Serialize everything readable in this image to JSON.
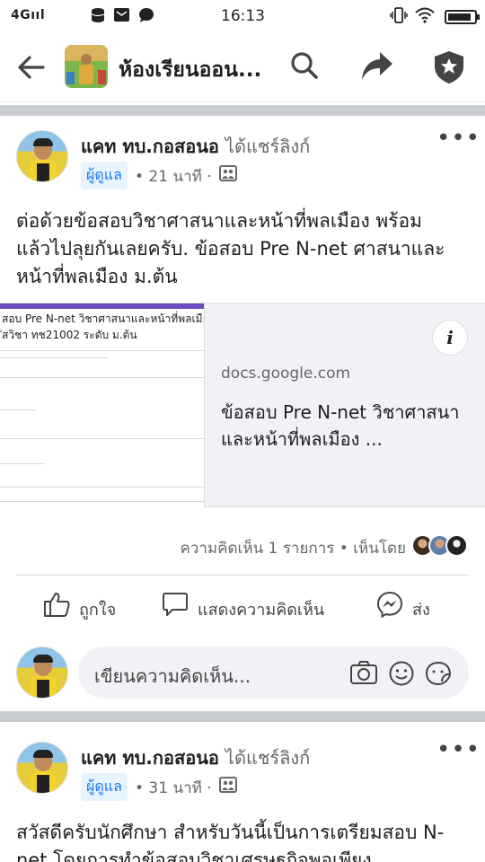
{
  "status_bar": {
    "signal": "4Gııl",
    "time": "16:13",
    "battery_level": 0.9
  },
  "header": {
    "title": "ห้องเรียนออน..."
  },
  "posts": [
    {
      "author": "แคท ทบ.กอสอนอ",
      "shared_text": "ได้แชร์ลิงก์",
      "role_badge": "ผู้ดูแล",
      "time": "• 21 นาที ·",
      "text": "ต่อด้วยข้อสอบวิชาศาสนาและหน้าที่พลเมือง  พร้อมแล้วไปลุยกันเลยครับ. ข้อสอบ Pre N-net ศาสนาและหน้าที่พลเมือง ม.ต้น",
      "link": {
        "thumb_title_line1": "สอบ Pre N-net วิชาศาสนาและหน้าที่พลเมือง",
        "thumb_title_line2": "ัสวิชา ทช21002 ระดับ ม.ต้น",
        "domain": "docs.google.com",
        "title": "ข้อสอบ Pre N-net วิชาศาสนาและหน้าที่พลเมือง ..."
      },
      "comments_summary": "ความคิดเห็น 1 รายการ • เห็นโดย",
      "actions": {
        "like": "ถูกใจ",
        "comment": "แสดงความคิดเห็น",
        "share": "ส่ง"
      },
      "comment_placeholder": "เขียนความคิดเห็น..."
    },
    {
      "author": "แคท ทบ.กอสอนอ",
      "shared_text": "ได้แชร์ลิงก์",
      "role_badge": "ผู้ดูแล",
      "time": "• 31 นาที ·",
      "text": "สวัสดีครับนักศึกษา สำหรับวันนี้เป็นการเตรียมสอบ N-net โดยการทำข้อสอบวิชาเศรษฐกิจพอเพียง"
    }
  ],
  "colors": {
    "accent": "#1877f2",
    "badge_bg": "#e7f3ff",
    "divider": "#c9ccd1",
    "secondary_text": "#65676b"
  }
}
